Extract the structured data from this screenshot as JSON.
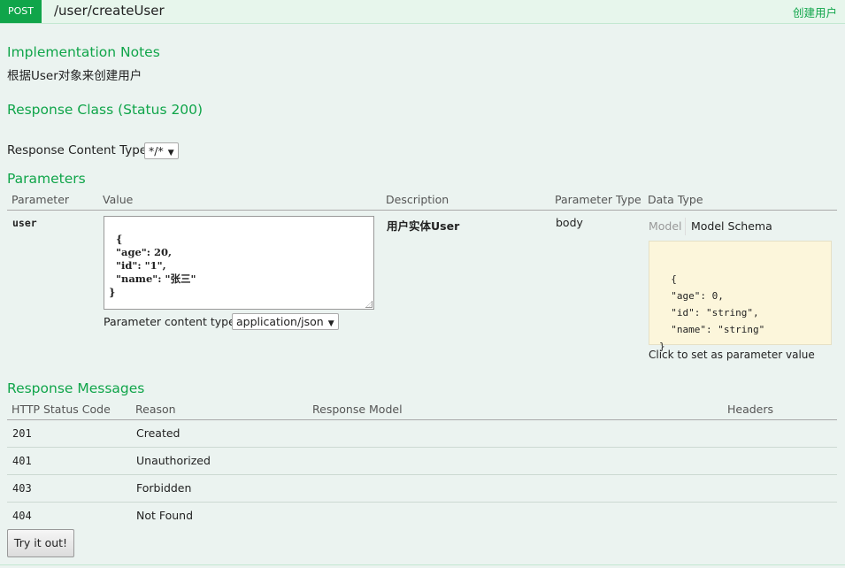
{
  "header": {
    "method": "POST",
    "path": "/user/createUser",
    "summary": "创建用户"
  },
  "implementation_notes": {
    "heading": "Implementation Notes",
    "text": "根据User对象来创建用户"
  },
  "response_class": {
    "heading": "Response Class (Status 200)",
    "content_type_label": "Response Content Type",
    "content_type_value": "*/*"
  },
  "parameters": {
    "heading": "Parameters",
    "columns": {
      "parameter": "Parameter",
      "value": "Value",
      "description": "Description",
      "parameter_type": "Parameter Type",
      "data_type": "Data Type"
    },
    "rows": [
      {
        "name": "user",
        "value": "{\n  \"age\": 20,\n  \"id\": \"1\",\n  \"name\": \"张三\"\n}",
        "content_type_label": "Parameter content type:",
        "content_type_value": "application/json",
        "description": "用户实体User",
        "parameter_type": "body",
        "data_type_tabs": [
          "Model",
          "Model Schema"
        ],
        "schema": "{\n  \"age\": 0,\n  \"id\": \"string\",\n  \"name\": \"string\"\n}",
        "schema_hint": "Click to set as parameter value"
      }
    ]
  },
  "response_messages": {
    "heading": "Response Messages",
    "columns": {
      "code": "HTTP Status Code",
      "reason": "Reason",
      "model": "Response Model",
      "headers": "Headers"
    },
    "rows": [
      {
        "code": "201",
        "reason": "Created"
      },
      {
        "code": "401",
        "reason": "Unauthorized"
      },
      {
        "code": "403",
        "reason": "Forbidden"
      },
      {
        "code": "404",
        "reason": "Not Found"
      }
    ]
  },
  "try_button": "Try it out!",
  "colors": {
    "accent": "#10a54a",
    "background": "#ebf3f0",
    "schema_bg": "#fcf6db"
  }
}
